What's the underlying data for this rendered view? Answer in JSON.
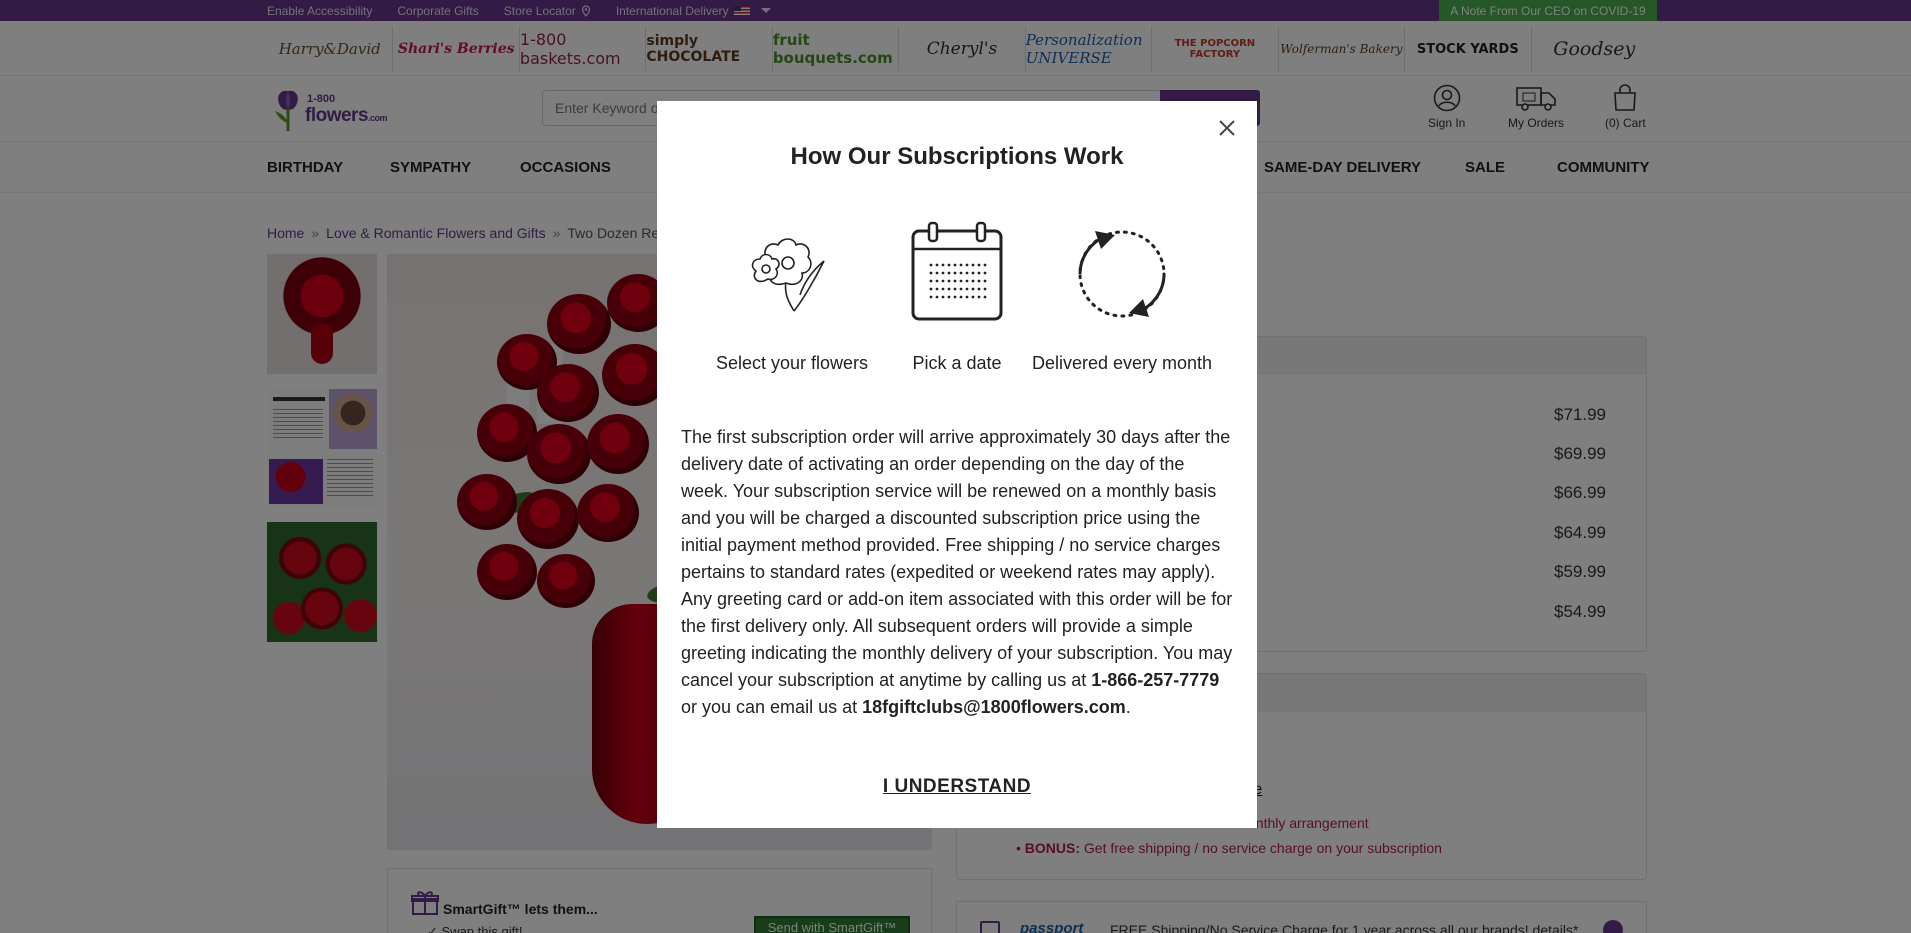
{
  "utility_bar": {
    "links": [
      "Enable Accessibility",
      "Corporate Gifts",
      "Store Locator",
      "International Delivery"
    ],
    "covid_note": "A Note From Our CEO on COVID-19"
  },
  "brands": [
    "Harry&David",
    "Shari's Berries",
    "1-800 baskets.com",
    "simply CHOCOLATE",
    "fruit bouquets.com",
    "Cheryl's",
    "Personalization UNIVERSE",
    "THE POPCORN FACTORY",
    "Wolferman's Bakery",
    "STOCK YARDS",
    "Goodsey"
  ],
  "header": {
    "logo_number": "1-800",
    "logo_word": "flowers",
    "logo_suffix": ".com",
    "search_placeholder": "Enter Keyword or Item #",
    "sign_in": "Sign In",
    "my_orders": "My Orders",
    "cart": "(0) Cart"
  },
  "nav": [
    "BIRTHDAY",
    "SYMPATHY",
    "OCCASIONS",
    "SAME-DAY DELIVERY",
    "SALE",
    "COMMUNITY"
  ],
  "breadcrumb": {
    "home": "Home",
    "category": "Love & Romantic Flowers and Gifts",
    "current": "Two Dozen Red Roses"
  },
  "prices": [
    "$71.99",
    "$69.99",
    "$66.99",
    "$64.99",
    "$59.99",
    "$54.99"
  ],
  "subscription_panel": {
    "details_fragment": "re",
    "bullet1": "onthly arrangement",
    "bullet2_prefix": "BONUS:",
    "bullet2": "Get free shipping / no service charge on your subscription"
  },
  "smartgift": {
    "title": "SmartGift™ lets them...",
    "line": "Swap this gift!",
    "button": "Send with SmartGift™"
  },
  "passport": {
    "logo": "passport",
    "text": "FREE Shipping/No Service Charge for 1 year across all our brands! details*"
  },
  "modal": {
    "title": "How Our Subscriptions Work",
    "steps": [
      {
        "label": "Select your flowers",
        "icon": "flower-icon"
      },
      {
        "label": "Pick a date",
        "icon": "calendar-icon"
      },
      {
        "label": "Delivered every month",
        "icon": "refresh-cycle-icon"
      }
    ],
    "body_text": "The first subscription order will arrive approximately 30 days after the delivery date of activating an order depending on the day of the week. Your subscription service will be renewed on a monthly basis and you will be charged a discounted subscription price using the initial payment method provided. Free shipping / no service charges pertains to standard rates (expedited or weekend rates may apply). Any greeting card or add-on item associated with this order will be for the first delivery only. All subsequent orders will provide a simple greeting indicating the monthly delivery of your subscription. You may cancel your subscription at anytime by calling us at ",
    "phone": "1-866-257-7779",
    "mid_text": " or you can email us at ",
    "email": "18fgiftclubs@1800flowers.com",
    "end_text": ".",
    "button": "I UNDERSTAND"
  },
  "colors": {
    "brand_purple": "#65388b",
    "covid_green": "#4caf50",
    "bonus_red": "#b01e4b"
  }
}
